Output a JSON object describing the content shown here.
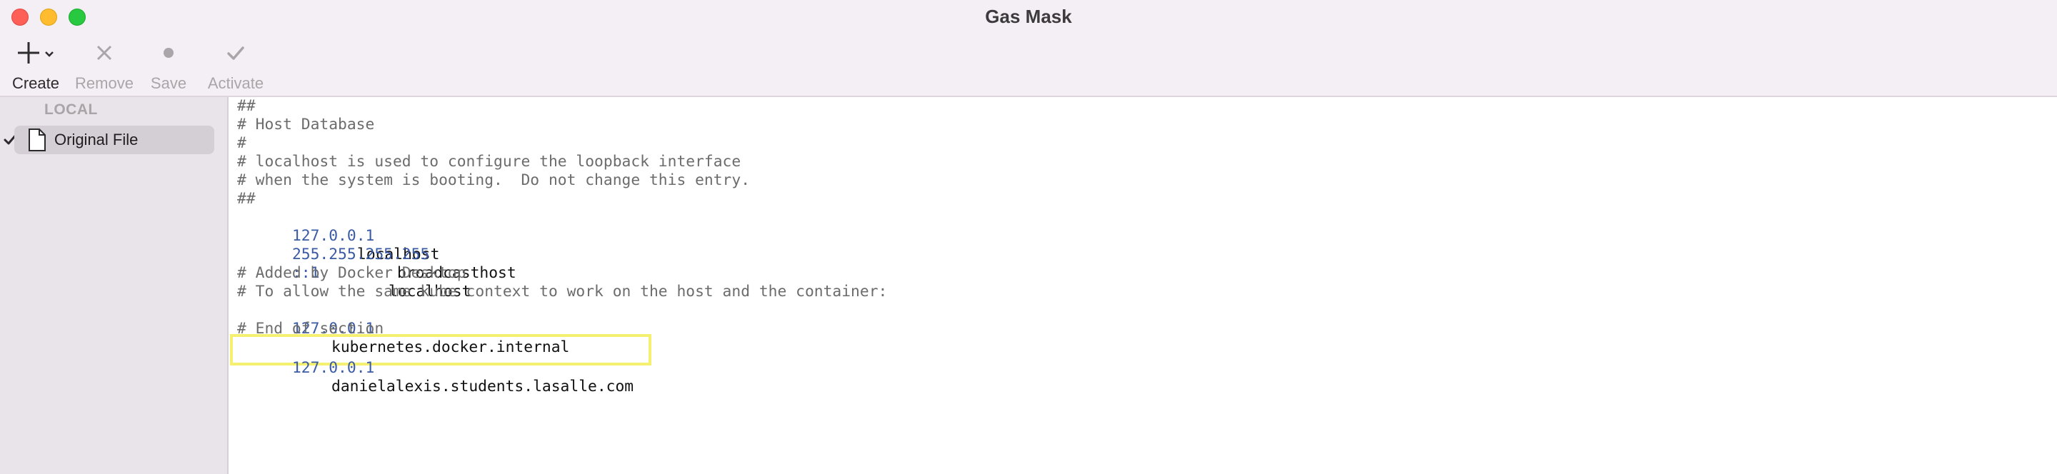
{
  "window": {
    "title": "Gas Mask"
  },
  "toolbar": {
    "create_label": "Create",
    "remove_label": "Remove",
    "save_label": "Save",
    "activate_label": "Activate"
  },
  "sidebar": {
    "section_header": "LOCAL",
    "items": [
      {
        "label": "Original File",
        "active": true
      }
    ]
  },
  "editor": {
    "comments": [
      "##",
      "# Host Database",
      "#",
      "# localhost is used to configure the loopback interface",
      "# when the system is booting.  Do not change this entry.",
      "##",
      "# Added by Docker Desktop",
      "# To allow the same kube context to work on the host and the container:",
      "# End of section"
    ],
    "entries": [
      {
        "ip": "127.0.0.1",
        "host": "localhost"
      },
      {
        "ip": "255.255.255.255",
        "host": "broadcasthost"
      },
      {
        "ip": "::1",
        "host": "localhost"
      },
      {
        "ip": "127.0.0.1",
        "host": "kubernetes.docker.internal"
      },
      {
        "ip": "127.0.0.1",
        "host": "danielalexis.students.lasalle.com"
      }
    ]
  },
  "colors": {
    "ip": "#3b5ba5",
    "comment": "#6c6c6c",
    "highlight": "#f5f070"
  }
}
